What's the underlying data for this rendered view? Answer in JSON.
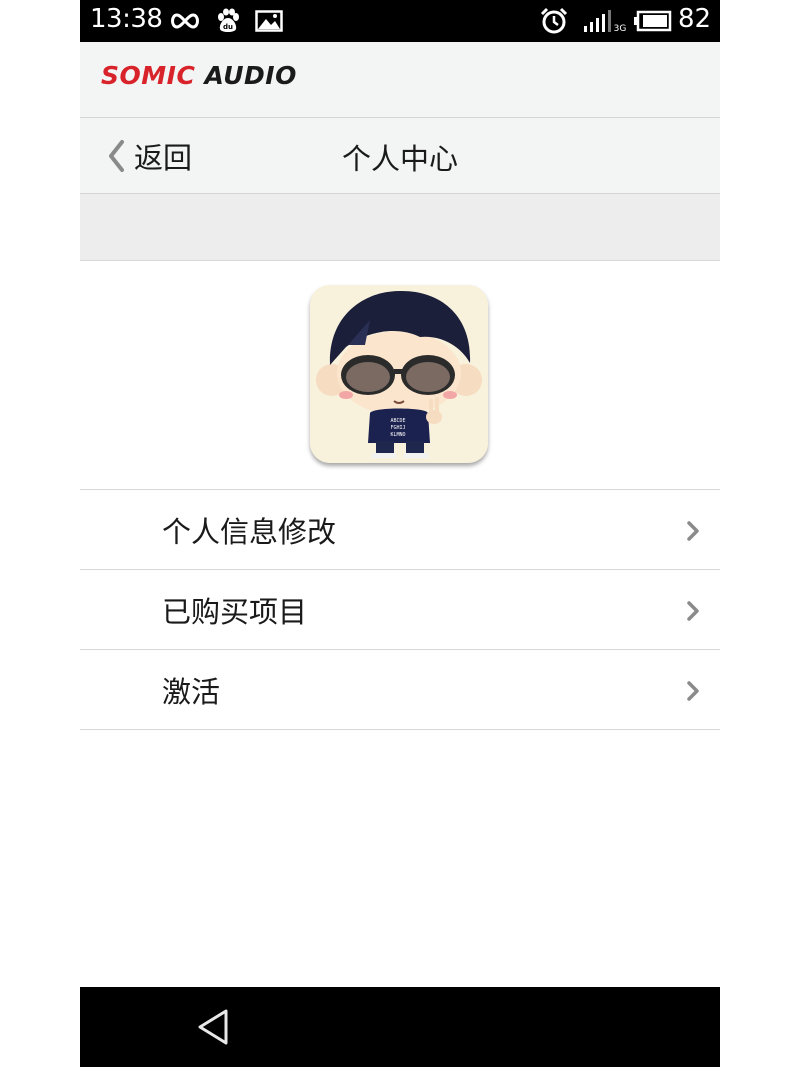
{
  "status_bar": {
    "time": "13:38",
    "battery_level": "82",
    "network": "3G",
    "icons": [
      "infinity-icon",
      "baidu-paw-icon",
      "image-icon",
      "alarm-icon",
      "signal-icon",
      "battery-icon"
    ]
  },
  "header": {
    "brand_part1": "SOMIC",
    "brand_part2": "AUDIO",
    "brand_color": "#d8232a"
  },
  "nav": {
    "back_label": "返回",
    "title": "个人中心"
  },
  "menu": {
    "items": [
      {
        "label": "个人信息修改"
      },
      {
        "label": "已购买项目"
      },
      {
        "label": "激活"
      }
    ]
  },
  "avatar": {
    "shirt_text": [
      "ABCDE",
      "FGHIJ",
      "KLMNO"
    ]
  },
  "colors": {
    "header_bg": "#f3f4f4",
    "band_bg": "#ededee",
    "divider": "#d8d8d8",
    "text": "#1a1a1a",
    "chevron": "#8a8a8a"
  }
}
